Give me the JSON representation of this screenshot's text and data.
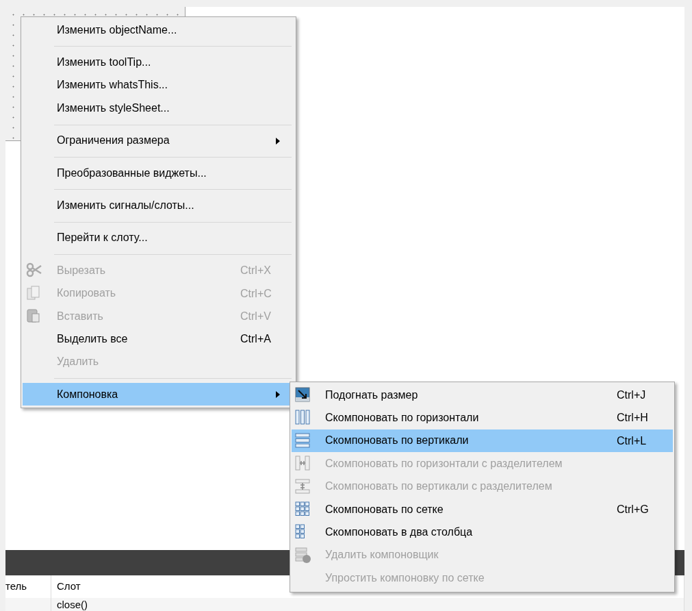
{
  "context_menu": {
    "items": [
      {
        "kind": "item",
        "label": "Изменить objectName...",
        "disabled": false,
        "selected": false
      },
      {
        "kind": "separator"
      },
      {
        "kind": "item",
        "label": "Изменить toolTip...",
        "disabled": false,
        "selected": false
      },
      {
        "kind": "item",
        "label": "Изменить whatsThis...",
        "disabled": false,
        "selected": false
      },
      {
        "kind": "item",
        "label": "Изменить styleSheet...",
        "disabled": false,
        "selected": false
      },
      {
        "kind": "separator"
      },
      {
        "kind": "submenu",
        "label": "Ограничения размера",
        "disabled": false,
        "selected": false
      },
      {
        "kind": "separator"
      },
      {
        "kind": "item",
        "label": "Преобразованные виджеты...",
        "disabled": false,
        "selected": false
      },
      {
        "kind": "separator"
      },
      {
        "kind": "item",
        "label": "Изменить сигналы/слоты...",
        "disabled": false,
        "selected": false
      },
      {
        "kind": "separator"
      },
      {
        "kind": "item",
        "label": "Перейти к слоту...",
        "disabled": false,
        "selected": false
      },
      {
        "kind": "separator"
      },
      {
        "kind": "item",
        "label": "Вырезать",
        "shortcut": "Ctrl+X",
        "disabled": true,
        "selected": false
      },
      {
        "kind": "item",
        "label": "Копировать",
        "shortcut": "Ctrl+C",
        "disabled": true,
        "selected": false
      },
      {
        "kind": "item",
        "label": "Вставить",
        "shortcut": "Ctrl+V",
        "disabled": true,
        "selected": false
      },
      {
        "kind": "item",
        "label": "Выделить все",
        "shortcut": "Ctrl+A",
        "disabled": false,
        "selected": false
      },
      {
        "kind": "item",
        "label": "Удалить",
        "disabled": true,
        "selected": false
      },
      {
        "kind": "separator"
      },
      {
        "kind": "submenu",
        "label": "Компоновка",
        "disabled": false,
        "selected": true
      }
    ]
  },
  "layout_submenu": {
    "items": [
      {
        "kind": "item",
        "label": "Подогнать размер",
        "shortcut": "Ctrl+J",
        "disabled": false,
        "selected": false
      },
      {
        "kind": "item",
        "label": "Скомпоновать по горизонтали",
        "shortcut": "Ctrl+H",
        "disabled": false,
        "selected": false
      },
      {
        "kind": "item",
        "label": "Скомпоновать по вертикали",
        "shortcut": "Ctrl+L",
        "disabled": false,
        "selected": true
      },
      {
        "kind": "item",
        "label": "Скомпоновать по горизонтали с разделителем",
        "disabled": true,
        "selected": false
      },
      {
        "kind": "item",
        "label": "Скомпоновать по вертикали с разделителем",
        "disabled": true,
        "selected": false
      },
      {
        "kind": "item",
        "label": "Скомпоновать по сетке",
        "shortcut": "Ctrl+G",
        "disabled": false,
        "selected": false
      },
      {
        "kind": "item",
        "label": "Скомпоновать в два столбца",
        "disabled": false,
        "selected": false
      },
      {
        "kind": "item",
        "label": "Удалить компоновщик",
        "disabled": true,
        "selected": false
      },
      {
        "kind": "item",
        "label": "Упростить компоновку по сетке",
        "disabled": true,
        "selected": false
      }
    ]
  },
  "table": {
    "columns": [
      "тель",
      "Слот"
    ],
    "rows": [
      [
        "",
        "close()"
      ]
    ]
  }
}
